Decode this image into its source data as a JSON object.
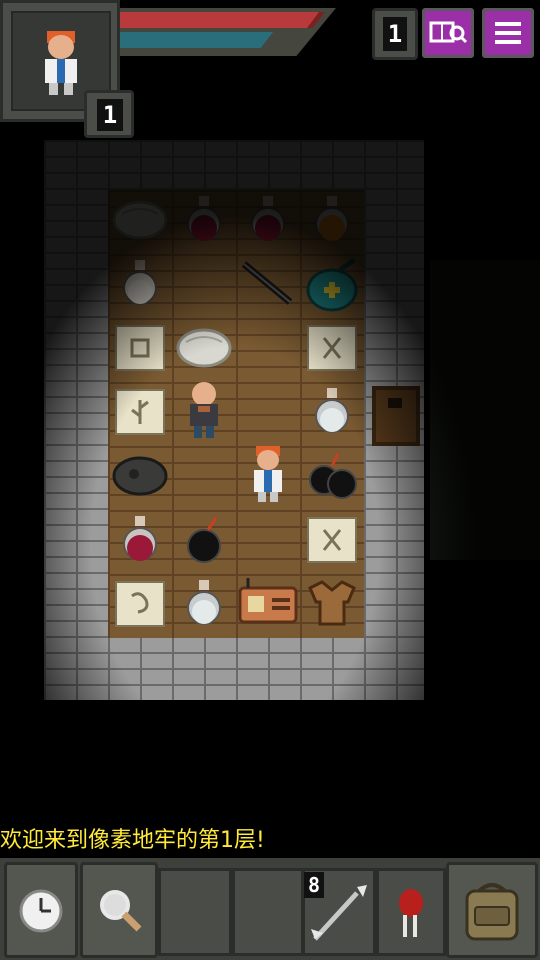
{
  "hud": {
    "hero_level": "1",
    "depth": "1",
    "hp_fraction": 0.97,
    "xp_fraction": 0.85,
    "journal_icon": "journal-search-icon",
    "menu_icon": "menu-icon"
  },
  "room_items": [
    {
      "name": "stone-item",
      "icon": "stone-icon"
    },
    {
      "name": "potion-crimson",
      "icon": "red-potion-icon"
    },
    {
      "name": "potion-crimson-2",
      "icon": "red-potion-icon"
    },
    {
      "name": "potion-amber",
      "icon": "orange-potion-icon"
    },
    {
      "name": "potion-milky",
      "icon": "white-potion-icon"
    },
    {
      "name": "wand",
      "icon": "wand-icon"
    },
    {
      "name": "seed-pouch",
      "icon": "green-pouch-icon"
    },
    {
      "name": "scroll-square",
      "icon": "scroll-icon"
    },
    {
      "name": "stone-item-2",
      "icon": "stone-icon"
    },
    {
      "name": "scroll-x",
      "icon": "scroll-icon"
    },
    {
      "name": "scroll-rune",
      "icon": "scroll-icon"
    },
    {
      "name": "shopkeeper",
      "icon": "shopkeeper-icon"
    },
    {
      "name": "potion-clear",
      "icon": "clear-potion-icon"
    },
    {
      "name": "ore",
      "icon": "ore-icon"
    },
    {
      "name": "hero",
      "icon": "hero-icon"
    },
    {
      "name": "bomb-pair",
      "icon": "bomb-icon"
    },
    {
      "name": "potion-crimson-3",
      "icon": "red-potion-icon"
    },
    {
      "name": "bomb",
      "icon": "bomb-icon"
    },
    {
      "name": "scroll-x-2",
      "icon": "scroll-icon"
    },
    {
      "name": "scroll-spiral",
      "icon": "scroll-icon"
    },
    {
      "name": "potion-clear-2",
      "icon": "clear-potion-icon"
    },
    {
      "name": "radio-box",
      "icon": "device-icon"
    },
    {
      "name": "armor",
      "icon": "leather-armor-icon"
    }
  ],
  "message": "欢迎来到像素地牢的第1层!",
  "toolbar": {
    "wait_icon": "clock-icon",
    "search_icon": "magnifier-icon",
    "quickslot_qty": "8",
    "quickslot_item": "dart-icon",
    "quickslot2_item": "seed-icon",
    "backpack_icon": "backpack-icon"
  },
  "colors": {
    "message_text": "#ffea3a",
    "menu_button": "#9a2fa7",
    "hp": "#b83a3a",
    "xp": "#2a6e7c"
  }
}
